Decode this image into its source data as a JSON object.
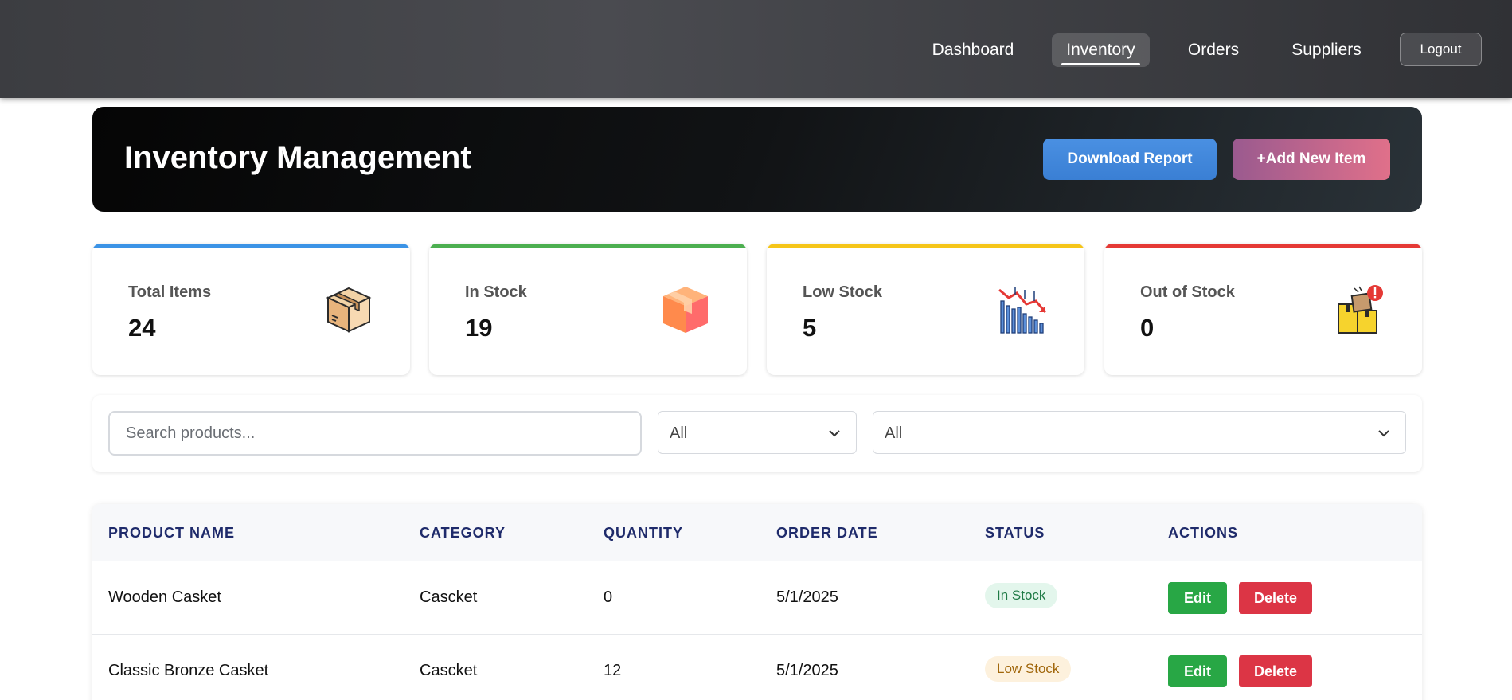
{
  "nav": {
    "links": [
      {
        "label": "Dashboard"
      },
      {
        "label": "Inventory"
      },
      {
        "label": "Orders"
      },
      {
        "label": "Suppliers"
      }
    ],
    "active": "Inventory",
    "logout_label": "Logout"
  },
  "header": {
    "title": "Inventory Management",
    "download_label": "Download Report",
    "add_label": "+Add New Item"
  },
  "stats": [
    {
      "label": "Total Items",
      "value": "24",
      "accent": "#3b93e6",
      "icon": "box-icon"
    },
    {
      "label": "In Stock",
      "value": "19",
      "accent": "#4caf50",
      "icon": "cube-icon"
    },
    {
      "label": "Low Stock",
      "value": "5",
      "accent": "#f5c518",
      "icon": "declining-chart-icon"
    },
    {
      "label": "Out of Stock",
      "value": "0",
      "accent": "#e53935",
      "icon": "empty-boxes-alert-icon"
    }
  ],
  "filters": {
    "search_placeholder": "Search products...",
    "category_value": "All",
    "status_value": "All"
  },
  "table": {
    "headers": [
      "PRODUCT NAME",
      "CATEGORY",
      "QUANTITY",
      "ORDER DATE",
      "STATUS",
      "ACTIONS"
    ],
    "rows": [
      {
        "name": "Wooden Casket",
        "category": "Cascket",
        "quantity": "0",
        "date": "5/1/2025",
        "status": "In Stock",
        "edit": "Edit",
        "delete": "Delete"
      },
      {
        "name": "Classic Bronze Casket",
        "category": "Cascket",
        "quantity": "12",
        "date": "5/1/2025",
        "status": "Low Stock",
        "edit": "Edit",
        "delete": "Delete"
      }
    ]
  }
}
